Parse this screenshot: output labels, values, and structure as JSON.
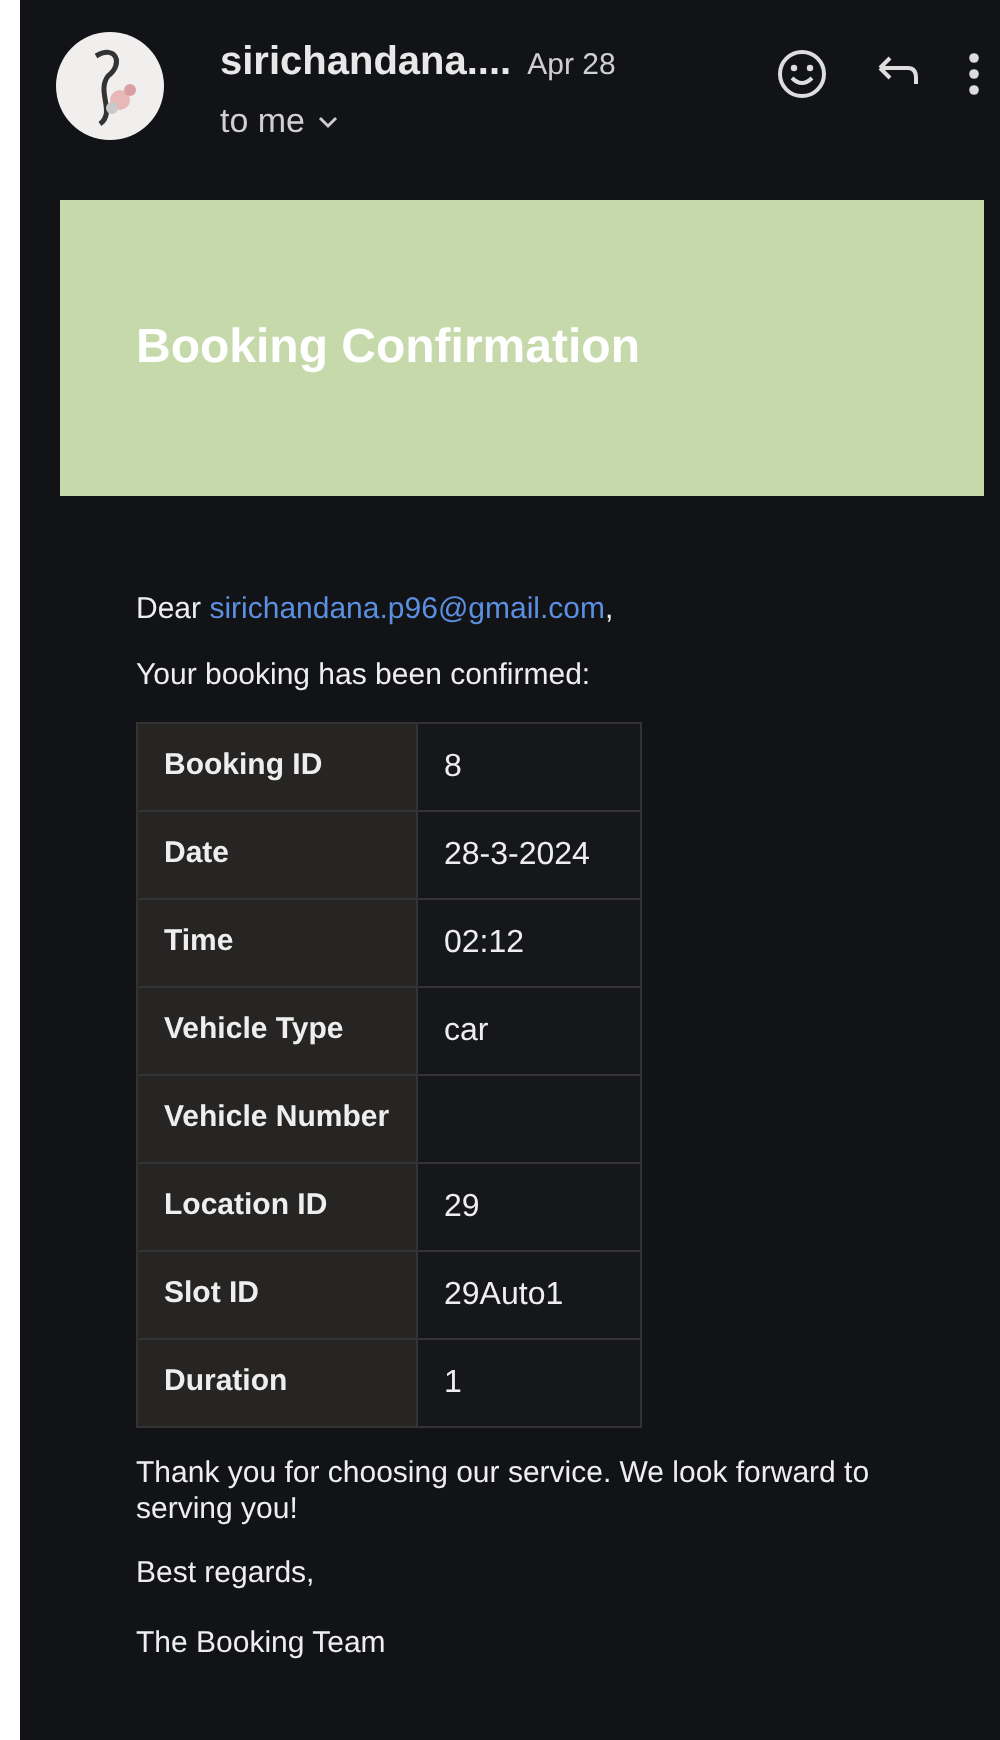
{
  "header": {
    "sender": "sirichandana....",
    "date": "Apr 28",
    "recipient": "to me"
  },
  "banner": {
    "title": "Booking Confirmation"
  },
  "greeting": {
    "prefix": "Dear",
    "email": "sirichandana.p96@gmail.com",
    "suffix": ","
  },
  "intro": "Your booking has been confirmed:",
  "details": [
    {
      "label": "Booking ID",
      "value": "8"
    },
    {
      "label": "Date",
      "value": "28-3-2024"
    },
    {
      "label": "Time",
      "value": "02:12"
    },
    {
      "label": "Vehicle Type",
      "value": "car"
    },
    {
      "label": "Vehicle Number"
    },
    {
      "label": "Location ID",
      "value": "29"
    },
    {
      "label": "Slot ID",
      "value": "29Auto1"
    },
    {
      "label": "Duration",
      "value": "1"
    }
  ],
  "closing": [
    "Thank you for choosing our service. We look forward to serving you!",
    "Best regards,",
    "The Booking Team"
  ]
}
